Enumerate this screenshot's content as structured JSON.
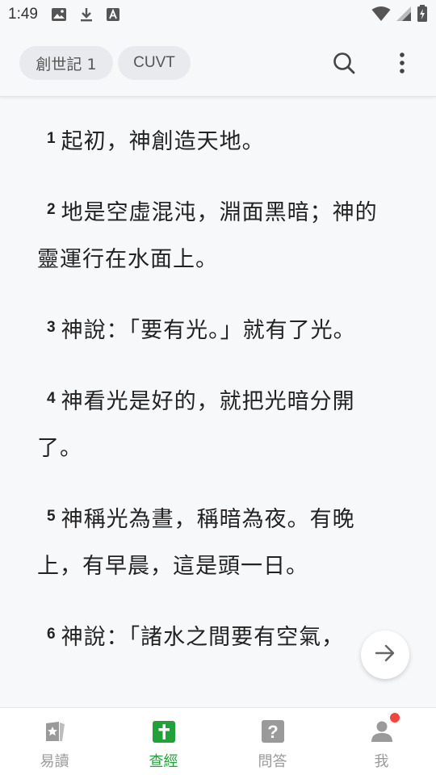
{
  "status_bar": {
    "time": "1:49",
    "icons": [
      "image-icon",
      "download-icon",
      "font-icon"
    ],
    "right_icons": [
      "wifi-icon",
      "signal-icon",
      "battery-icon"
    ]
  },
  "app_bar": {
    "book_chip": "創世記 1",
    "version_chip": "CUVT",
    "search_icon": "search-icon",
    "more_icon": "more-vert-icon"
  },
  "verses": [
    {
      "num": "1",
      "text": "起初，神創造天地。"
    },
    {
      "num": "2",
      "text": "地是空虛混沌，淵面黑暗；神的靈運行在水面上。"
    },
    {
      "num": "3",
      "text": "神說：「要有光。」就有了光。"
    },
    {
      "num": "4",
      "text": "神看光是好的，就把光暗分開了。"
    },
    {
      "num": "5",
      "text": "神稱光為晝，稱暗為夜。有晚上，有早晨，這是頭一日。"
    },
    {
      "num": "6",
      "text": "神說：「諸水之間要有空氣，"
    }
  ],
  "fab": {
    "icon": "arrow-right-icon"
  },
  "bottom_nav": {
    "items": [
      {
        "label": "易讀",
        "icon": "star-book-icon",
        "active": false
      },
      {
        "label": "查經",
        "icon": "bible-cross-icon",
        "active": true
      },
      {
        "label": "問答",
        "icon": "question-icon",
        "active": false
      },
      {
        "label": "我",
        "icon": "person-icon",
        "active": false
      }
    ]
  },
  "colors": {
    "accent": "#22a03a",
    "inactive": "#9a9a9a",
    "badge": "#f2453d",
    "background": "#f7f8fa"
  }
}
